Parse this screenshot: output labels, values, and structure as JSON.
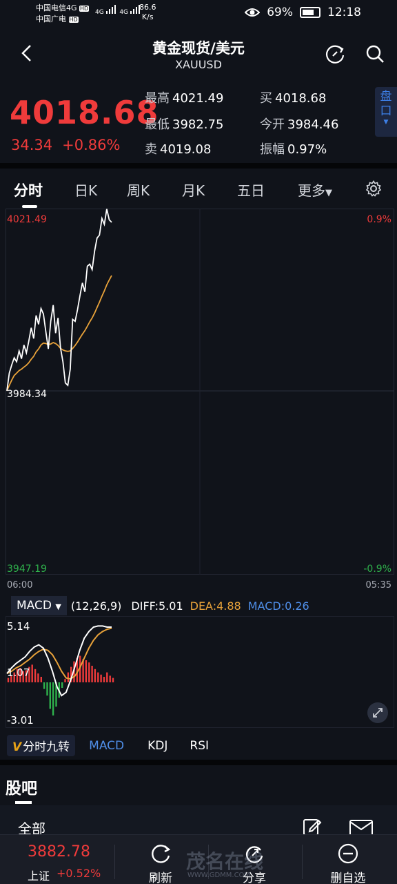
{
  "status_bar": {
    "carrier1": "中国电信4G",
    "carrier2": "中国广电",
    "hd": "HD",
    "net": "4G",
    "speed_value": "86.6",
    "speed_unit": "K/s",
    "battery": "69%",
    "time": "12:18"
  },
  "header": {
    "title": "黄金现货/美元",
    "subtitle": "XAUUSD"
  },
  "quote": {
    "price": "4018.68",
    "change": "34.34",
    "change_pct": "+0.86%",
    "high_label": "最高",
    "high": "4021.49",
    "low_label": "最低",
    "low": "3982.75",
    "ask_label": "卖",
    "ask": "4019.08",
    "bid_label": "买",
    "bid": "4018.68",
    "open_label": "今开",
    "open": "3984.46",
    "amp_label": "振幅",
    "amp": "0.97%",
    "pankou": "盘口"
  },
  "tabs": [
    "分时",
    "日K",
    "周K",
    "月K",
    "五日",
    "更多"
  ],
  "chart_labels": {
    "top_price": "4021.49",
    "mid_price": "3984.34",
    "bottom_price": "3947.19",
    "top_pct": "0.9%",
    "bottom_pct": "-0.9%",
    "time_start": "06:00",
    "time_end": "05:35"
  },
  "macd": {
    "selector": "MACD",
    "params": "(12,26,9)",
    "diff": "DIFF:5.01",
    "dea": "DEA:4.88",
    "macd": "MACD:0.26",
    "y_top": "5.14",
    "y_mid": "1.07",
    "y_bottom": "-3.01"
  },
  "indicator_tabs": {
    "jiuzhuan": "分时九转",
    "macd": "MACD",
    "kdj": "KDJ",
    "rsi": "RSI"
  },
  "guba": {
    "title": "股吧",
    "filter": "全部"
  },
  "bottom_nav": {
    "index_value": "3882.78",
    "index_name": "上证",
    "index_change": "+0.52%",
    "refresh": "刷新",
    "share": "分享",
    "remove": "删自选"
  },
  "watermark": {
    "text": "茂名在线",
    "url": "WWW.GDMM.COM"
  },
  "colors": {
    "up": "#ef3b3b",
    "down": "#2fb24c",
    "price_line": "#ffffff",
    "avg_line": "#e8a23a",
    "accent": "#3d7fe6"
  },
  "chart_data": {
    "type": "line",
    "title": "",
    "ylim": [
      3947.19,
      4021.49
    ],
    "baseline": 3984.34,
    "series": [
      {
        "values": [
          3984.5,
          3988.1,
          3989.8,
          3991.2,
          3990.4,
          3992.6,
          3991.0,
          3993.8,
          3992.2,
          3994.6,
          3997.3,
          3995.1,
          3999.8,
          3998.0,
          4001.2,
          4000.1,
          3996.4,
          3993.0,
          3998.6,
          4001.9,
          3996.2,
          3999.3,
          3993.2,
          3990.4,
          3986.1,
          3985.6,
          3988.9,
          3999.0,
          3998.6,
          4001.0,
          4003.8,
          4006.4,
          4004.6,
          4009.8,
          4010.2,
          4009.1,
          4012.9,
          4015.5,
          4016.1,
          4019.5,
          4018.3,
          4021.4,
          4019.2,
          4018.7
        ]
      },
      {
        "values": [
          3984.5,
          3985.6,
          3986.7,
          3987.6,
          3988.1,
          3988.6,
          3988.9,
          3989.3,
          3989.7,
          3990.2,
          3990.9,
          3991.5,
          3992.4,
          3993.0,
          3993.8,
          3994.2,
          3994.1,
          3993.9,
          3994.0,
          3994.3,
          3994.1,
          3993.7,
          3993.1,
          3992.8,
          3992.6,
          3992.5,
          3992.6,
          3993.1,
          3993.7,
          3994.4,
          3995.2,
          3996.0,
          3996.7,
          3997.6,
          3998.5,
          3999.3,
          4000.3,
          4001.4,
          4002.5,
          4003.7,
          4004.8,
          4006.0,
          4007.0,
          4007.9
        ]
      }
    ],
    "macd_hist": [
      0.4,
      0.6,
      0.9,
      1.2,
      1.3,
      1.0,
      1.1,
      1.4,
      1.6,
      1.2,
      0.8,
      0.5,
      -0.6,
      -1.2,
      -2.4,
      -3.0,
      -2.2,
      -1.4,
      -0.5,
      0.3,
      0.9,
      1.4,
      1.9,
      2.2,
      2.4,
      2.1,
      2.0,
      1.8,
      1.5,
      1.2,
      0.9,
      0.7,
      0.5,
      0.9,
      0.6,
      0.4
    ],
    "diff": [
      0.8,
      1.3,
      1.7,
      2.0,
      2.3,
      2.8,
      3.2,
      3.4,
      3.1,
      2.2,
      1.0,
      -0.4,
      -1.2,
      -0.9,
      0.2,
      1.5,
      2.9,
      4.0,
      4.6,
      5.0,
      5.1,
      5.1,
      5.0,
      5.0
    ],
    "dea": [
      0.8,
      1.0,
      1.3,
      1.5,
      1.8,
      2.1,
      2.5,
      2.8,
      3.0,
      2.9,
      2.5,
      1.8,
      1.0,
      0.4,
      0.3,
      0.6,
      1.3,
      2.2,
      3.1,
      3.8,
      4.3,
      4.6,
      4.8,
      4.9
    ]
  }
}
